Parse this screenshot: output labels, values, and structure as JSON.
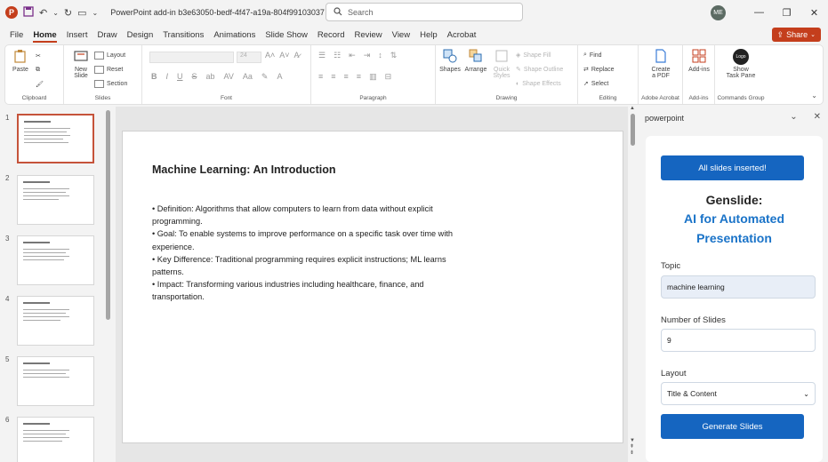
{
  "window": {
    "app_logo": "P",
    "doc_title": "PowerPoint add-in b3e63050-bedf-4f47-a19a-804f99103037  -  PowerP...",
    "search_placeholder": "Search",
    "avatar_initials": "ME",
    "controls": {
      "minimize": "—",
      "restore": "❐",
      "close": "✕"
    }
  },
  "menu": {
    "tabs": [
      "File",
      "Home",
      "Insert",
      "Draw",
      "Design",
      "Transitions",
      "Animations",
      "Slide Show",
      "Record",
      "Review",
      "View",
      "Help",
      "Acrobat"
    ],
    "active": "Home",
    "share_label": "Share"
  },
  "ribbon": {
    "clipboard": {
      "paste": "Paste",
      "label": "Clipboard"
    },
    "slides": {
      "new_slide": "New",
      "new_slide2": "Slide",
      "layout": "Layout",
      "reset": "Reset",
      "section": "Section",
      "label": "Slides"
    },
    "font": {
      "font_size": "24",
      "bold": "B",
      "italic": "I",
      "underline": "U",
      "strike": "S",
      "shadow": "ab",
      "spacing": "AV",
      "case": "Aa",
      "label": "Font"
    },
    "paragraph": {
      "label": "Paragraph"
    },
    "drawing": {
      "shapes": "Shapes",
      "arrange": "Arrange",
      "quick_styles": "Quick",
      "quick_styles2": "Styles",
      "shape_fill": "Shape Fill",
      "shape_outline": "Shape Outline",
      "shape_effects": "Shape Effects",
      "label": "Drawing"
    },
    "editing": {
      "find": "Find",
      "replace": "Replace",
      "select": "Select",
      "label": "Editing"
    },
    "acrobat": {
      "create_pdf": "Create",
      "create_pdf2": "a PDF",
      "label": "Adobe Acrobat"
    },
    "addins": {
      "addins": "Add-ins",
      "label": "Add-ins"
    },
    "commands": {
      "logo": "Logo",
      "show": "Show",
      "show2": "Task Pane",
      "label": "Commands Group"
    }
  },
  "thumbnails": {
    "numbers": [
      "1",
      "2",
      "3",
      "4",
      "5",
      "6"
    ],
    "active_index": 0
  },
  "slide": {
    "title": "Machine Learning: An Introduction",
    "bullets": [
      "• Definition: Algorithms that allow computers to learn from data without explicit programming.",
      "• Goal: To enable systems to improve performance on a specific task over time with experience.",
      "• Key Difference: Traditional programming requires explicit instructions; ML learns patterns.",
      "• Impact: Transforming various industries including healthcare, finance, and transportation."
    ]
  },
  "taskpane": {
    "header": "powerpoint",
    "status_button": "All slides inserted!",
    "title_line1": "Genslide:",
    "title_line2": "AI for Automated",
    "title_line3": "Presentation",
    "topic_label": "Topic",
    "topic_value": "machine learning",
    "num_label": "Number of Slides",
    "num_value": "9",
    "layout_label": "Layout",
    "layout_value": "Title & Content",
    "generate_button": "Generate Slides",
    "accent_color": "#1565c0"
  }
}
